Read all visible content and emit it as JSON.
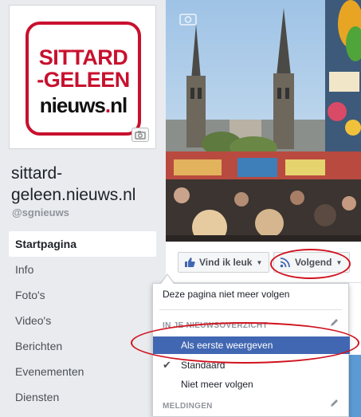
{
  "page": {
    "name": "sittard-\ngeleen.nieuws.nl",
    "handle": "@sgnieuws"
  },
  "logo": {
    "line1": "SITTARD",
    "line2": "-GELEEN",
    "line3_main": "nieuws",
    "line3_dot": ".",
    "line3_tld": "nl",
    "brand_color": "#c8102e"
  },
  "nav": {
    "items": [
      {
        "label": "Startpagina",
        "active": true
      },
      {
        "label": "Info"
      },
      {
        "label": "Foto's"
      },
      {
        "label": "Video's"
      },
      {
        "label": "Berichten"
      },
      {
        "label": "Evenementen"
      },
      {
        "label": "Diensten"
      }
    ]
  },
  "actions": {
    "like_label": "Vind ik leuk",
    "follow_label": "Volgend"
  },
  "dropdown": {
    "unfollow_page": "Deze pagina niet meer volgen",
    "section_newsfeed": "IN JE NIEUWSOVERZICHT",
    "options": [
      {
        "label": "Als eerste weergeven",
        "selected": true
      },
      {
        "label": "Standaard",
        "checked": true
      },
      {
        "label": "Niet meer volgen"
      }
    ],
    "section_notifications": "MELDINGEN"
  },
  "colors": {
    "facebook_blue": "#4267b2",
    "annotation_red": "#d0131e"
  }
}
